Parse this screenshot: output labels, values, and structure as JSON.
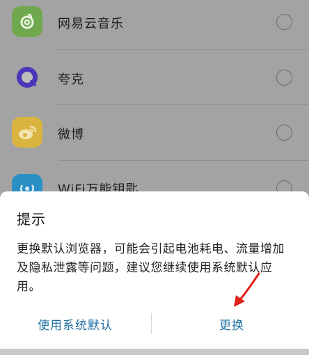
{
  "app_list": {
    "items": [
      {
        "label": "网易云音乐",
        "icon": "netease-music-icon",
        "color": "#6fa84d"
      },
      {
        "label": "夸克",
        "icon": "quark-icon",
        "color": "#4a36b8"
      },
      {
        "label": "微博",
        "icon": "weibo-icon",
        "color": "#d9b441"
      },
      {
        "label": "WiFi万能钥匙",
        "icon": "wifi-key-icon",
        "color": "#2b8fc4"
      }
    ]
  },
  "dialog": {
    "title": "提示",
    "message": "更换默认浏览器，可能会引起电池耗电、流量增加及隐私泄露等问题，建议您继续使用系统默认应用。",
    "use_default_label": "使用系统默认",
    "change_label": "更换",
    "accent_color": "#1e6fa0"
  },
  "annotation": {
    "arrow_color": "#e0201b"
  }
}
